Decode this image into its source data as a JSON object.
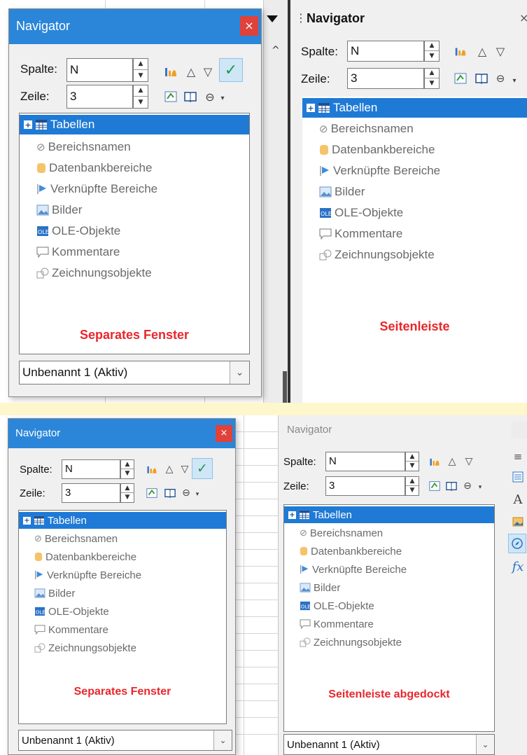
{
  "colors": {
    "titlebar": "#2b86d9",
    "close": "#e0413a",
    "selection": "#1f7ad6",
    "caption_red": "#e8272c",
    "separator_yellow": "#fff7cc"
  },
  "nav": {
    "title": "Navigator",
    "close_glyph": "×",
    "column_label": "Spalte:",
    "column_value": "N",
    "row_label": "Zeile:",
    "row_value": "3",
    "combo_value": "Unbenannt 1 (Aktiv)",
    "items": [
      {
        "label": "Tabellen",
        "icon": "table-icon"
      },
      {
        "label": "Bereichsnamen",
        "icon": "range-names-icon"
      },
      {
        "label": "Datenbankbereiche",
        "icon": "database-icon"
      },
      {
        "label": "Verknüpfte Bereiche",
        "icon": "linked-areas-icon"
      },
      {
        "label": "Bilder",
        "icon": "image-icon"
      },
      {
        "label": "OLE-Objekte",
        "icon": "ole-icon"
      },
      {
        "label": "Kommentare",
        "icon": "comment-icon"
      },
      {
        "label": "Zeichnungsobjekte",
        "icon": "drawing-icon"
      }
    ]
  },
  "captions": {
    "q1": "Separates Fenster",
    "q2": "Seitenleiste",
    "q3": "Separates Fenster",
    "q4": "Seitenleiste abgedockt"
  }
}
